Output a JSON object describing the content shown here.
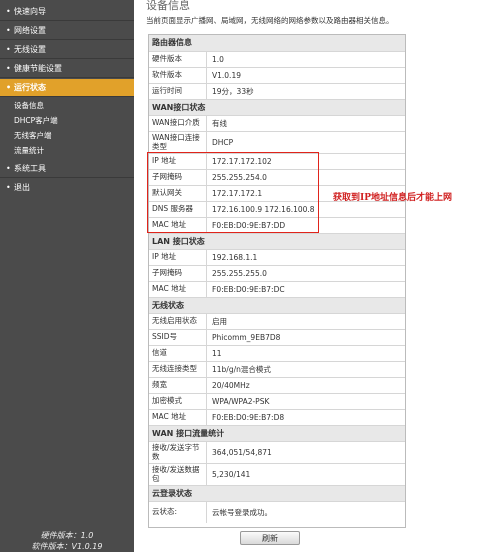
{
  "sidebar": {
    "items": [
      {
        "label": "快速向导"
      },
      {
        "label": "网络设置"
      },
      {
        "label": "无线设置"
      },
      {
        "label": "健康节能设置"
      },
      {
        "label": "运行状态"
      },
      {
        "label": "系统工具"
      },
      {
        "label": "退出"
      }
    ],
    "subitems": [
      {
        "label": "设备信息"
      },
      {
        "label": "DHCP客户端"
      },
      {
        "label": "无线客户端"
      },
      {
        "label": "流量统计"
      }
    ],
    "footer_hw": "硬件版本：1.0",
    "footer_sw": "软件版本：V1.0.19"
  },
  "page": {
    "title": "设备信息",
    "description": "当前页面显示广播网、局域网，无线网络的网络参数以及路由器相关信息。",
    "refresh_label": "刷新",
    "annotation": "获取到IP地址信息后才能上网"
  },
  "sections": {
    "router": {
      "title": "路由器信息",
      "rows": [
        {
          "label": "硬件版本",
          "value": "1.0"
        },
        {
          "label": "软件版本",
          "value": "V1.0.19"
        },
        {
          "label": "运行时间",
          "value": "19分，33秒"
        }
      ]
    },
    "wan": {
      "title": "WAN接口状态",
      "rows": [
        {
          "label": "WAN接口介质",
          "value": "有线"
        },
        {
          "label": "WAN接口连接类型",
          "value": "DHCP"
        },
        {
          "label": "IP 地址",
          "value": "172.17.172.102"
        },
        {
          "label": "子网掩码",
          "value": "255.255.254.0"
        },
        {
          "label": "默认网关",
          "value": "172.17.172.1"
        },
        {
          "label": "DNS 服务器",
          "value": "172.16.100.9 172.16.100.8"
        },
        {
          "label": "MAC 地址",
          "value": "F0:EB:D0:9E:B7:DD"
        }
      ]
    },
    "lan": {
      "title": "LAN 接口状态",
      "rows": [
        {
          "label": "IP 地址",
          "value": "192.168.1.1"
        },
        {
          "label": "子网掩码",
          "value": "255.255.255.0"
        },
        {
          "label": "MAC 地址",
          "value": "F0:EB:D0:9E:B7:DC"
        }
      ]
    },
    "wireless": {
      "title": "无线状态",
      "rows": [
        {
          "label": "无线启用状态",
          "value": "启用"
        },
        {
          "label": "SSID号",
          "value": "Phicomm_9EB7D8"
        },
        {
          "label": "信道",
          "value": "11"
        },
        {
          "label": "无线连接类型",
          "value": "11b/g/n混合模式"
        },
        {
          "label": "频宽",
          "value": "20/40MHz"
        },
        {
          "label": "加密模式",
          "value": "WPA/WPA2-PSK"
        },
        {
          "label": "MAC 地址",
          "value": "F0:EB:D0:9E:B7:D8"
        }
      ]
    },
    "traffic": {
      "title": "WAN 接口流量统计",
      "rows": [
        {
          "label": "接收/发送字节数",
          "value": "364,051/54,871"
        },
        {
          "label": "接收/发送数据包",
          "value": "5,230/141"
        }
      ]
    },
    "cloud": {
      "title": "云登录状态",
      "rows": [
        {
          "label": "云状态:",
          "value": "云帐号登录成功。"
        }
      ]
    }
  }
}
